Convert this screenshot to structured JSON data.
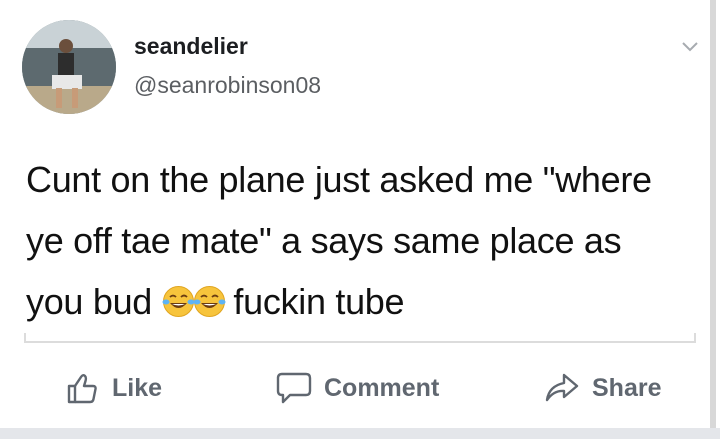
{
  "post": {
    "username": "seandelier",
    "handle": "@seanrobinson08",
    "text_line1": "Cunt on the plane just asked me \"where",
    "text_line2": "ye off tae mate\" a says same place as",
    "text_line3_before": "you bud ",
    "text_line3_after": " fuckin tube",
    "emojis": [
      "face-with-tears-of-joy-icon",
      "face-with-tears-of-joy-icon"
    ]
  },
  "actions": {
    "like_label": "Like",
    "comment_label": "Comment",
    "share_label": "Share"
  },
  "colors": {
    "action_gray": "#606770",
    "text": "#111111",
    "handle": "#5b5e62",
    "emoji_yellow": "#f7c43c"
  }
}
